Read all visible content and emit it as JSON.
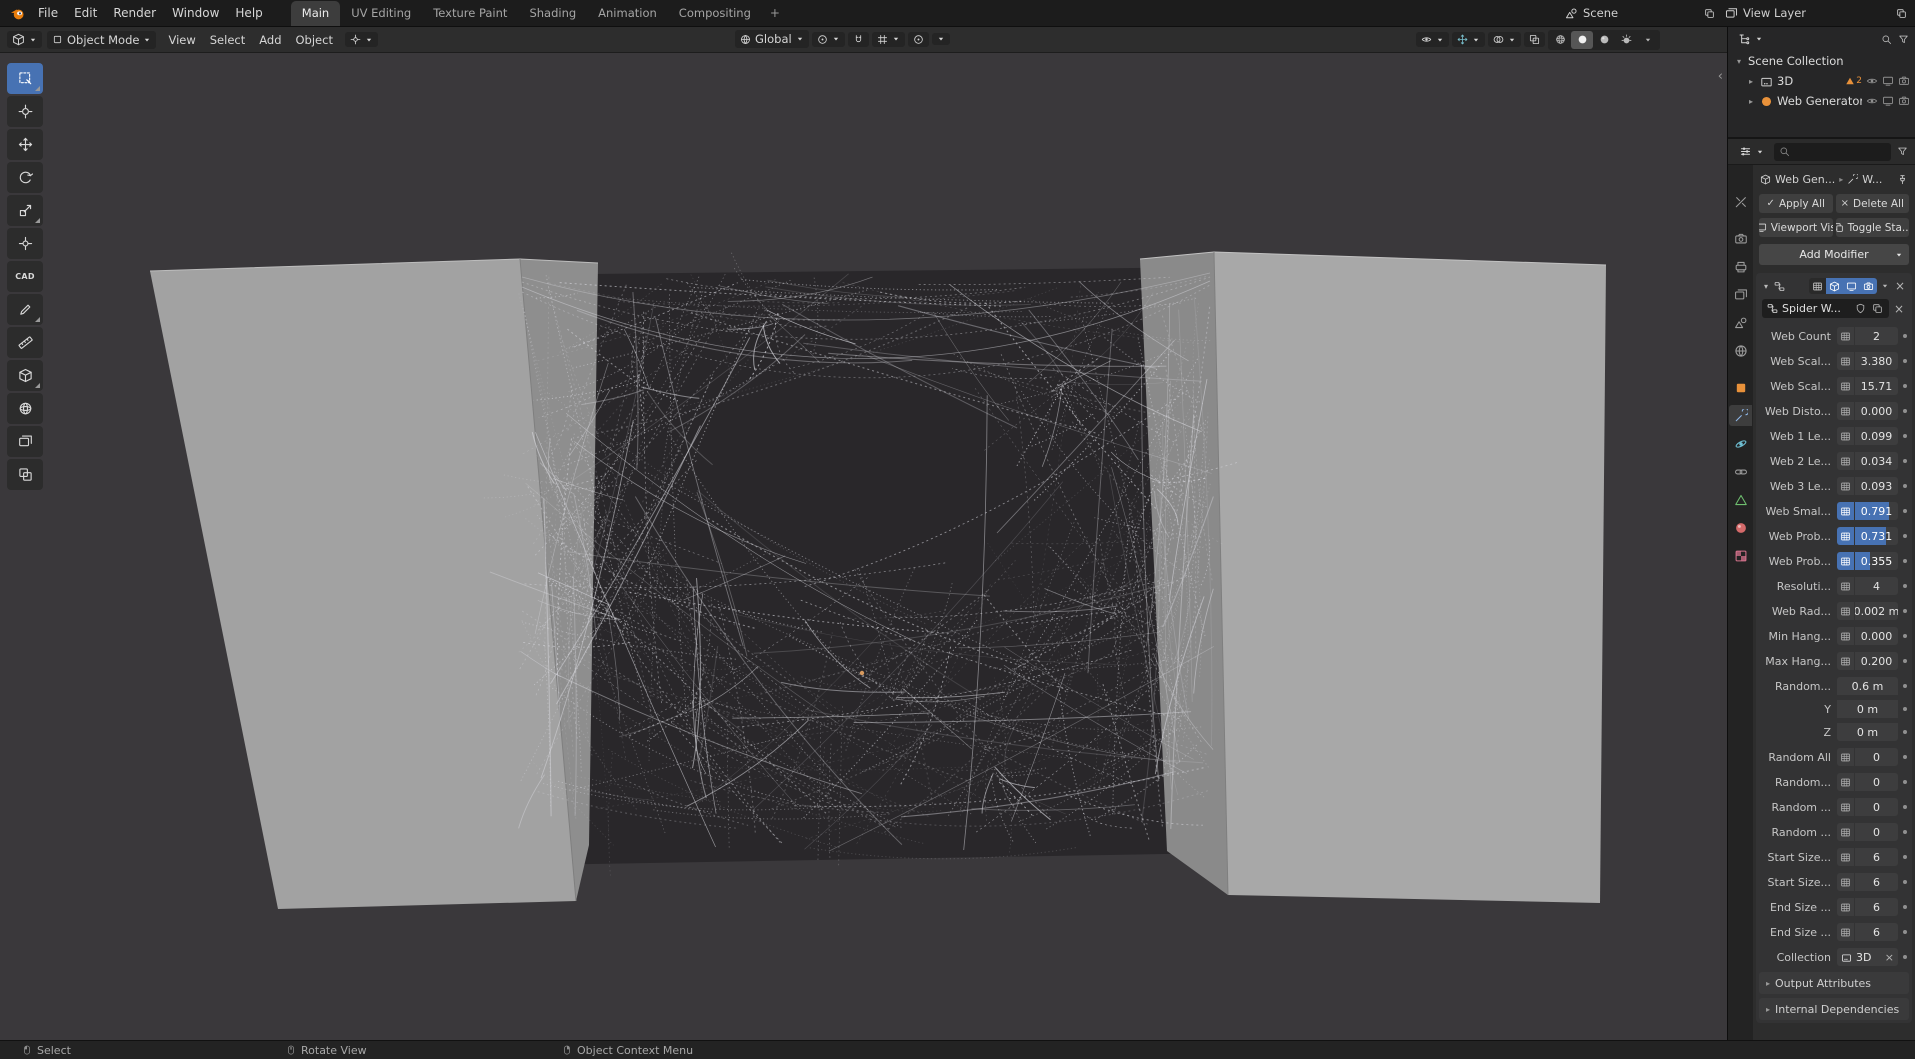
{
  "colors": {
    "accent": "#4772b3",
    "object_orange": "#e8913a"
  },
  "topbar": {
    "menus": [
      "File",
      "Edit",
      "Render",
      "Window",
      "Help"
    ],
    "workspaces": [
      "Main",
      "UV Editing",
      "Texture Paint",
      "Shading",
      "Animation",
      "Compositing"
    ],
    "active_workspace": "Main",
    "new_workspace_label": "+",
    "scene": {
      "label": "Scene"
    },
    "view_layer": {
      "label": "View Layer"
    }
  },
  "viewport": {
    "header": {
      "mode": "Object Mode",
      "menus": [
        "View",
        "Select",
        "Add",
        "Object"
      ],
      "orientation": "Global"
    },
    "tools": [
      {
        "id": "select-box",
        "icon": "selectbox",
        "active": true,
        "sub": true
      },
      {
        "id": "cursor",
        "icon": "cursor3d"
      },
      {
        "id": "move",
        "icon": "move"
      },
      {
        "id": "rotate",
        "icon": "rotate"
      },
      {
        "id": "scale",
        "icon": "scale",
        "sub": true
      },
      {
        "id": "transform",
        "icon": "transform"
      },
      {
        "id": "cad-sketcher",
        "text": "CAD"
      },
      {
        "id": "annotate",
        "icon": "pencil",
        "sub": true
      },
      {
        "id": "measure",
        "icon": "ruler"
      },
      {
        "id": "add-cube",
        "icon": "cube",
        "sub": true
      },
      {
        "id": "add-sphere",
        "icon": "spherewire"
      },
      {
        "id": "image-reference",
        "icon": "images"
      },
      {
        "id": "clip-region",
        "icon": "xray"
      }
    ],
    "sidebar_toggle": "‹"
  },
  "outliner": {
    "rows": [
      {
        "label": "Scene Collection",
        "depth": 0,
        "disclosure": "▾"
      },
      {
        "label": "3D",
        "depth": 1,
        "disclosure": "▸",
        "icon": "collection",
        "badge": {
          "count": "2"
        },
        "toggles": [
          "eye",
          "monitor",
          "camera"
        ]
      },
      {
        "label": "Web Generator",
        "depth": 1,
        "disclosure": "▸",
        "icon": "sphere",
        "orange": true,
        "toggles": [
          "eye",
          "monitor",
          "camera"
        ]
      }
    ]
  },
  "properties": {
    "tabs": [
      {
        "id": "tool",
        "icon": "tooltab"
      },
      {
        "id": "render",
        "icon": "camera",
        "gap": true
      },
      {
        "id": "output",
        "icon": "printer"
      },
      {
        "id": "view-layer",
        "icon": "images"
      },
      {
        "id": "scene",
        "icon": "scene"
      },
      {
        "id": "world",
        "icon": "world"
      },
      {
        "id": "object",
        "icon": "square",
        "color": "#e8913a",
        "gap": true
      },
      {
        "id": "modifiers",
        "icon": "wrench",
        "color": "#90b8e8",
        "active": true
      },
      {
        "id": "physics",
        "icon": "physics",
        "color": "#6fc0d4"
      },
      {
        "id": "constraints",
        "icon": "constraint"
      },
      {
        "id": "data",
        "icon": "tri",
        "color": "#6fbf6f"
      },
      {
        "id": "material",
        "icon": "spherehi",
        "color": "#d46a6a"
      },
      {
        "id": "texture",
        "icon": "checker",
        "color": "#d4738c"
      }
    ],
    "breadcrumb": {
      "object": "Web Gen...",
      "modifier": "W..."
    },
    "actions": {
      "apply_all": "Apply All",
      "delete_all": "Delete All",
      "viewport_vis": "Viewport Vis",
      "toggle_stack": "Toggle Sta..."
    },
    "add_modifier_label": "Add Modifier",
    "modifier": {
      "name": "Spider W...",
      "toggles": [
        {
          "icon": "grid",
          "on": false
        },
        {
          "icon": "cube",
          "on": true
        },
        {
          "icon": "monitor",
          "on": true
        },
        {
          "icon": "camera",
          "on": true
        }
      ],
      "params": [
        {
          "label": "Web Count",
          "value": "2"
        },
        {
          "label": "Web Scal...",
          "value": "3.380"
        },
        {
          "label": "Web Scal...",
          "value": "15.71"
        },
        {
          "label": "Web Disto...",
          "value": "0.000"
        },
        {
          "label": "Web 1 Le...",
          "value": "0.099"
        },
        {
          "label": "Web 2 Le...",
          "value": "0.034"
        },
        {
          "label": "Web 3 Le...",
          "value": "0.093"
        },
        {
          "label": "Web Smal...",
          "value": "0.791",
          "fill": 0.79
        },
        {
          "label": "Web Prob...",
          "value": "0.731",
          "fill": 0.73
        },
        {
          "label": "Web Prob...",
          "value": "0.355",
          "fill": 0.36
        },
        {
          "label": "Resoluti...",
          "value": "4"
        },
        {
          "label": "Web Rad...",
          "value": "0.002 m"
        },
        {
          "label": "Min Hang...",
          "value": "0.000"
        },
        {
          "label": "Max Hang...",
          "value": "0.200"
        },
        {
          "label": "Random...",
          "value": "0.6 m",
          "vector": "start"
        },
        {
          "label": "Y",
          "value": "0 m",
          "vector": "mid"
        },
        {
          "label": "Z",
          "value": "0 m",
          "vector": "end"
        },
        {
          "label": "Random All",
          "value": "0"
        },
        {
          "label": "Random...",
          "value": "0"
        },
        {
          "label": "Random ...",
          "value": "0"
        },
        {
          "label": "Random ...",
          "value": "0"
        },
        {
          "label": "Start Size...",
          "value": "6"
        },
        {
          "label": "Start Size...",
          "value": "6"
        },
        {
          "label": "End Size ...",
          "value": "6"
        },
        {
          "label": "End Size ...",
          "value": "6"
        }
      ],
      "collection": {
        "label": "Collection",
        "value": "3D"
      },
      "panels": [
        "Output Attributes",
        "Internal Dependencies"
      ]
    }
  },
  "statusbar": {
    "items": [
      {
        "icon": "mouse-l",
        "label": "Select"
      },
      {
        "icon": "mouse-m",
        "label": "Rotate View"
      },
      {
        "icon": "mouse-r",
        "label": "Object Context Menu"
      }
    ]
  }
}
